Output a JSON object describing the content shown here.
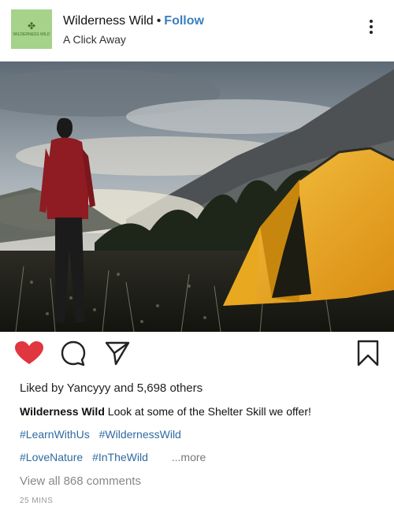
{
  "header": {
    "account_name": "Wilderness Wild",
    "separator": "•",
    "follow_label": "Follow",
    "subtitle": "A Click Away",
    "avatar_icon": "wilderness-logo-icon",
    "avatar_text": "WILDERNESS WILD",
    "avatar_color": "#a6d28a",
    "menu_icon": "more-vertical-icon"
  },
  "photo": {
    "subject": "hiker-and-tent-photo",
    "tent_color": "#f2b01e"
  },
  "actions": {
    "like_icon": "heart-filled-icon",
    "like_color": "#e0363f",
    "comment_icon": "comment-icon",
    "share_icon": "send-icon",
    "save_icon": "bookmark-icon"
  },
  "likes": {
    "prefix": "Liked by",
    "user": "Yancyyy",
    "connector": "and",
    "others": "5,698 others"
  },
  "caption": {
    "author": "Wilderness Wild",
    "text": "Look at some of the Shelter Skill we offer!"
  },
  "hashtags_line1": [
    "#LearnWithUs",
    "#WildernessWild"
  ],
  "hashtags_line2": [
    "#LoveNature",
    "#InTheWild"
  ],
  "more_label": "...more",
  "view_comments": "View all 868 comments",
  "timestamp": "25 MINS",
  "link_color": "#2f6aa0",
  "follow_color": "#3a7fc1"
}
